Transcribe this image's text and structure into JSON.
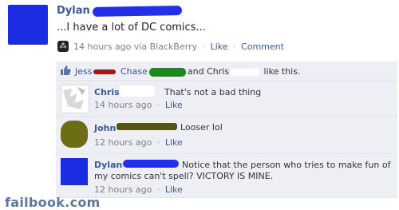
{
  "post": {
    "name": "Dylan",
    "text": "...I have a lot of DC comics...",
    "time": "14 hours ago via BlackBerry",
    "like_label": "Like",
    "comment_label": "Comment",
    "sep": "·"
  },
  "likes": {
    "name1": "Jess",
    "name2": "Chase",
    "and": "and Chris",
    "suffix": "like this."
  },
  "comments": [
    {
      "name": "Chris",
      "text": "That's not a bad thing",
      "time": "14 hours ago",
      "like": "Like"
    },
    {
      "name": "John",
      "text": "Looser lol",
      "time": "12 hours ago",
      "like": "Like"
    },
    {
      "name": "Dylan",
      "text": "Notice that the person who tries to make fun of my comics can't spell? VICTORY IS MINE.",
      "time": "12 hours ago",
      "like": "Like"
    }
  ],
  "footer": {
    "brand": "failbook.com"
  },
  "colors": {
    "link": "#3b5998",
    "comment_bg": "#edeff4",
    "scribble_blue": "#2430e8"
  }
}
